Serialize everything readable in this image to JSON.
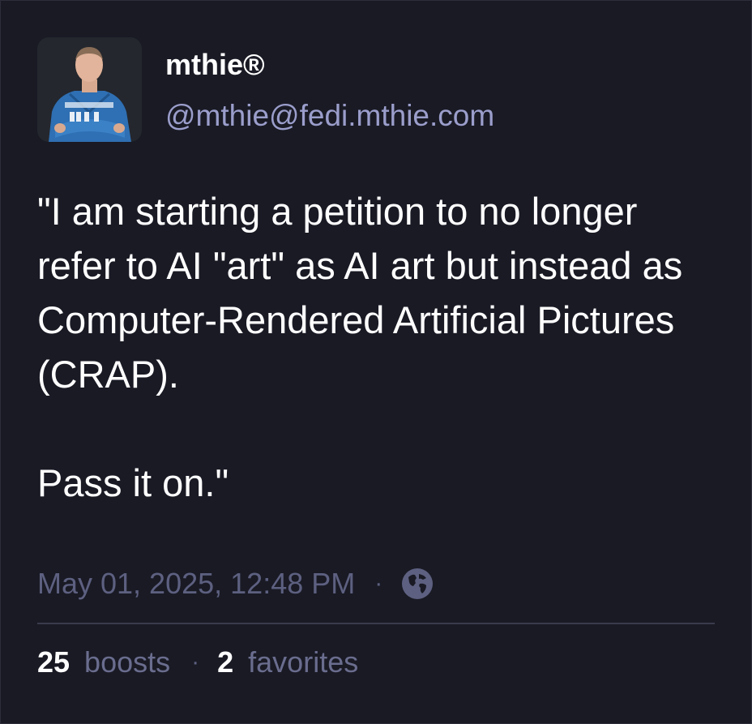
{
  "author": {
    "display_name": "mthie®",
    "handle": "@mthie@fedi.mthie.com"
  },
  "post": {
    "paragraphs": [
      "\"I am starting a petition to no longer refer to AI \"art\" as AI art but instead as Computer-Rendered Artificial Pictures (CRAP).",
      "Pass it on.\""
    ],
    "timestamp": "May 01, 2025, 12:48 PM",
    "separator": "·",
    "visibility_icon": "globe-icon"
  },
  "stats": {
    "boosts_count": "25",
    "boosts_label": "boosts",
    "separator": "·",
    "favorites_count": "2",
    "favorites_label": "favorites"
  },
  "colors": {
    "background": "#191a24",
    "text": "#ffffff",
    "handle": "#9b9ecb",
    "muted": "#5d6080",
    "divider": "#3a3b4c"
  }
}
